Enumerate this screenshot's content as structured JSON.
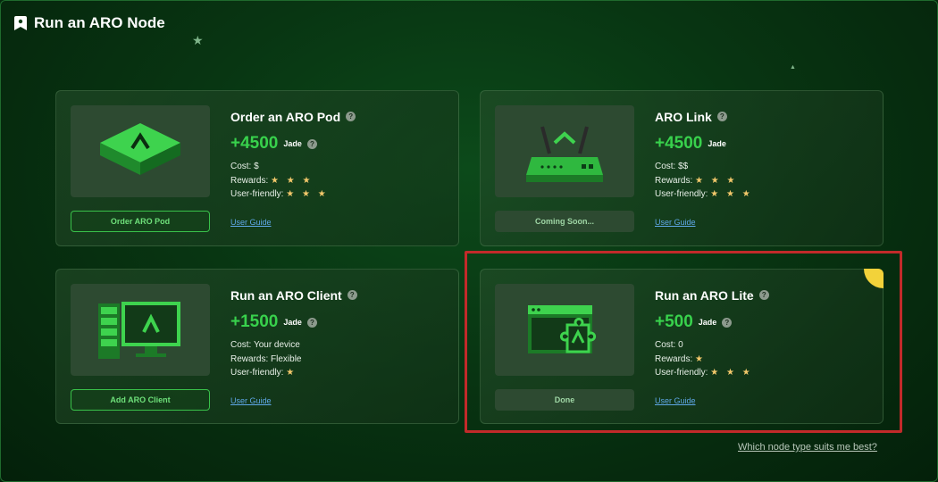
{
  "header": {
    "title": "Run an ARO Node"
  },
  "cards": [
    {
      "title": "Order an ARO Pod",
      "points": "+4500",
      "unit": "Jade",
      "cost": "Cost: $",
      "rewards_label": "Rewards:",
      "rewards_stars": "★ ★ ★",
      "friendly_label": "User-friendly:",
      "friendly_stars": "★ ★ ★",
      "action": "Order ARO Pod",
      "guide": "User Guide",
      "icon": "aro-pod-device-icon"
    },
    {
      "title": "ARO Link",
      "points": "+4500",
      "unit": "Jade",
      "cost": "Cost: $$",
      "rewards_label": "Rewards:",
      "rewards_stars": "★ ★ ★",
      "friendly_label": "User-friendly:",
      "friendly_stars": "★ ★ ★",
      "action": "Coming Soon...",
      "guide": "User Guide",
      "icon": "router-icon"
    },
    {
      "title": "Run an ARO Client",
      "points": "+1500",
      "unit": "Jade",
      "cost": "Cost: Your device",
      "rewards_label": "Rewards: Flexible",
      "rewards_stars": "",
      "friendly_label": "User-friendly:",
      "friendly_stars": "★",
      "action": "Add ARO Client",
      "guide": "User Guide",
      "icon": "desktop-server-icon"
    },
    {
      "title": "Run an ARO Lite",
      "points": "+500",
      "unit": "Jade",
      "cost": "Cost: 0",
      "rewards_label": "Rewards:",
      "rewards_stars": "★",
      "friendly_label": "User-friendly:",
      "friendly_stars": "★ ★ ★",
      "action": "Done",
      "guide": "User Guide",
      "icon": "browser-extension-icon"
    }
  ],
  "footer": {
    "link": "Which node type suits me best?"
  },
  "help_glyph": "?",
  "colors": {
    "accent": "#38d14c",
    "highlight": "#c22a2a",
    "star": "#f3c86b",
    "link": "#5fa8e8"
  }
}
